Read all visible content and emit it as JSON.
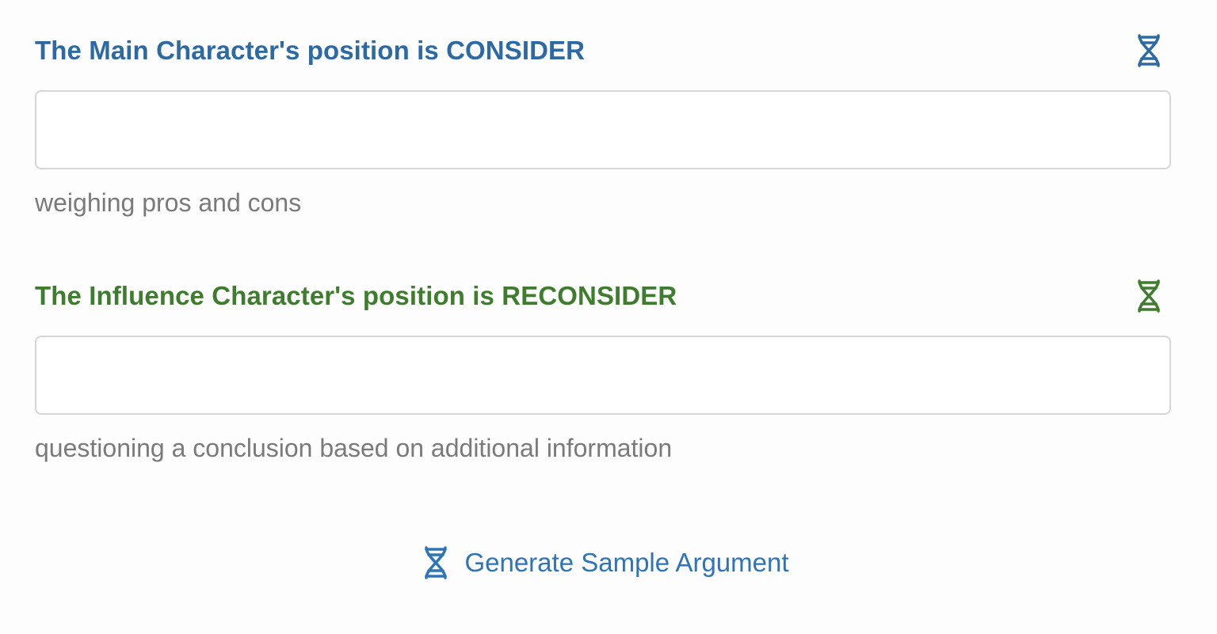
{
  "main": {
    "title": "The Main Character's position is CONSIDER",
    "input_value": "",
    "hint": "weighing pros and cons",
    "icon": "dna-icon",
    "color": "#2d6aa3"
  },
  "influence": {
    "title": "The Influence Character's position is RECONSIDER",
    "input_value": "",
    "hint": "questioning a conclusion based on additional information",
    "icon": "dna-icon",
    "color": "#3e7d2d"
  },
  "generate": {
    "label": "Generate Sample Argument",
    "icon": "dna-icon",
    "color": "#2f74b8"
  }
}
